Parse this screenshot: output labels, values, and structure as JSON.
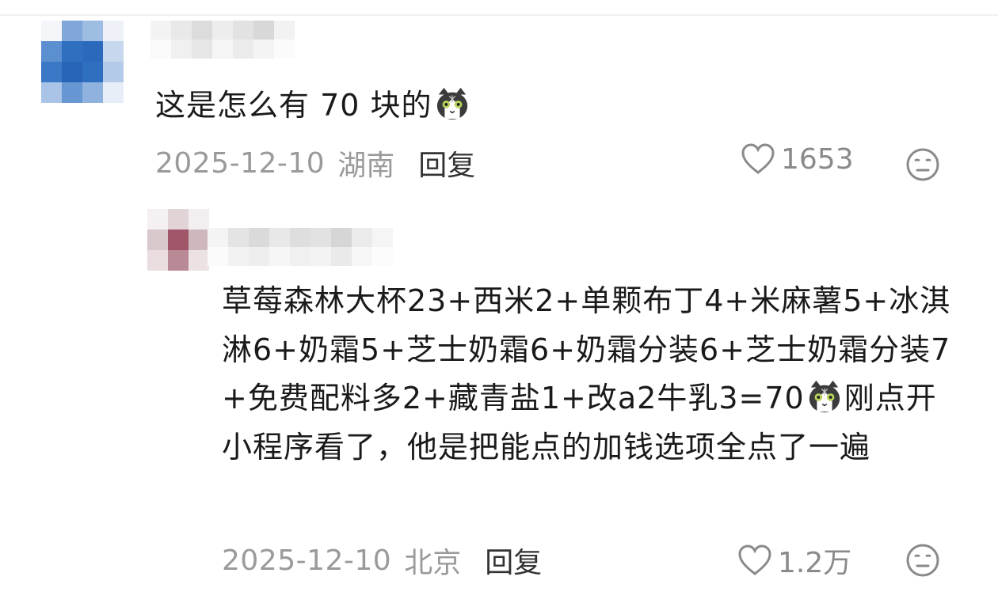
{
  "comments": [
    {
      "text": "这是怎么有 70 块的",
      "date": "2025-12-10",
      "location": "湖南",
      "reply_label": "回复",
      "likes": "1653"
    },
    {
      "text_before_emoji": "草莓森林大杯23+西米2+单颗布丁4+米麻薯5+冰淇淋6+奶霜5+芝士奶霜6+奶霜分装6+芝士奶霜分装7+免费配料多2+藏青盐1+改a2牛乳3=70",
      "text_after_emoji": "刚点开小程序看了，他是把能点的加钱选项全点了一遍",
      "date": "2025-12-10",
      "location": "北京",
      "reply_label": "回复",
      "likes": "1.2万"
    }
  ],
  "icons": {
    "emoji": "cat-face-icon",
    "like": "heart-icon",
    "dislike": "neutral-face-icon"
  },
  "colors": {
    "text": "#1a1a1a",
    "meta": "#9a9a9a",
    "reply": "#333333",
    "icon": "#8a8a8a",
    "avatar_blue": "#2f6fc0",
    "avatar_maroon": "#a05568"
  }
}
